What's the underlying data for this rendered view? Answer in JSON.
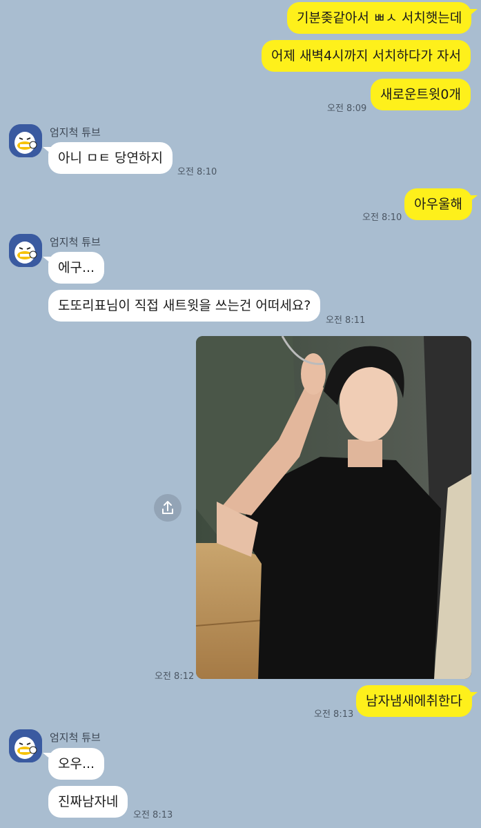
{
  "colors": {
    "background": "#a9bdd0",
    "my_bubble": "#fef01b",
    "other_bubble": "#ffffff"
  },
  "contact": {
    "name": "엄지척 튜브",
    "avatar_icon": "tube-thumbs-up-emoticon"
  },
  "messages": {
    "m1": {
      "text": "기분좆같아서 ㅃㅅ 서치햇는데"
    },
    "m2": {
      "text": "어제 새벽4시까지 서치하다가 자서"
    },
    "m3": {
      "text": "새로운트윗0개",
      "time": "오전 8:09"
    },
    "m4": {
      "text": "아니 ㅁㅌ 당연하지",
      "time": "오전 8:10"
    },
    "m5": {
      "text": "아우울해",
      "time": "오전 8:10"
    },
    "m6": {
      "text": "에구..."
    },
    "m7": {
      "text": "도또리표님이 직접 새트윗을 쓰는건 어떠세요?",
      "time": "오전 8:11"
    },
    "m8": {
      "image_desc_icon": "photo-attachment",
      "time": "오전 8:12",
      "share_icon": "share-icon"
    },
    "m9": {
      "text": "남자냄새에취한다",
      "time": "오전 8:13"
    },
    "m10": {
      "text": "오우..."
    },
    "m11": {
      "text": "진짜남자네",
      "time": "오전 8:13"
    }
  }
}
